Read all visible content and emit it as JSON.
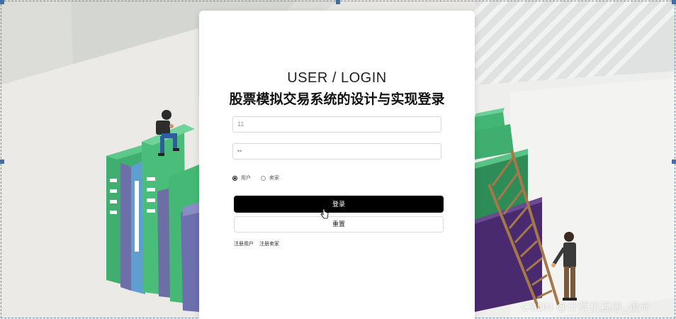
{
  "login": {
    "title": "USER / LOGIN",
    "subtitle": "股票模拟交易系统的设计与实现登录",
    "username_value": "11",
    "password_value": "••",
    "roles": [
      "用户",
      "卖家"
    ],
    "selected_role": "用户",
    "login_button": "登录",
    "reset_button": "重置",
    "links": [
      "注册用户",
      "注册卖家"
    ]
  },
  "watermark": "CSDN @计算机程序_设计",
  "colors": {
    "primary_button": "#000000",
    "book_green": "#46b876",
    "book_purple": "#6b6fa3",
    "book_dark_purple": "#4a2a6e",
    "ladder": "#a5784a"
  }
}
